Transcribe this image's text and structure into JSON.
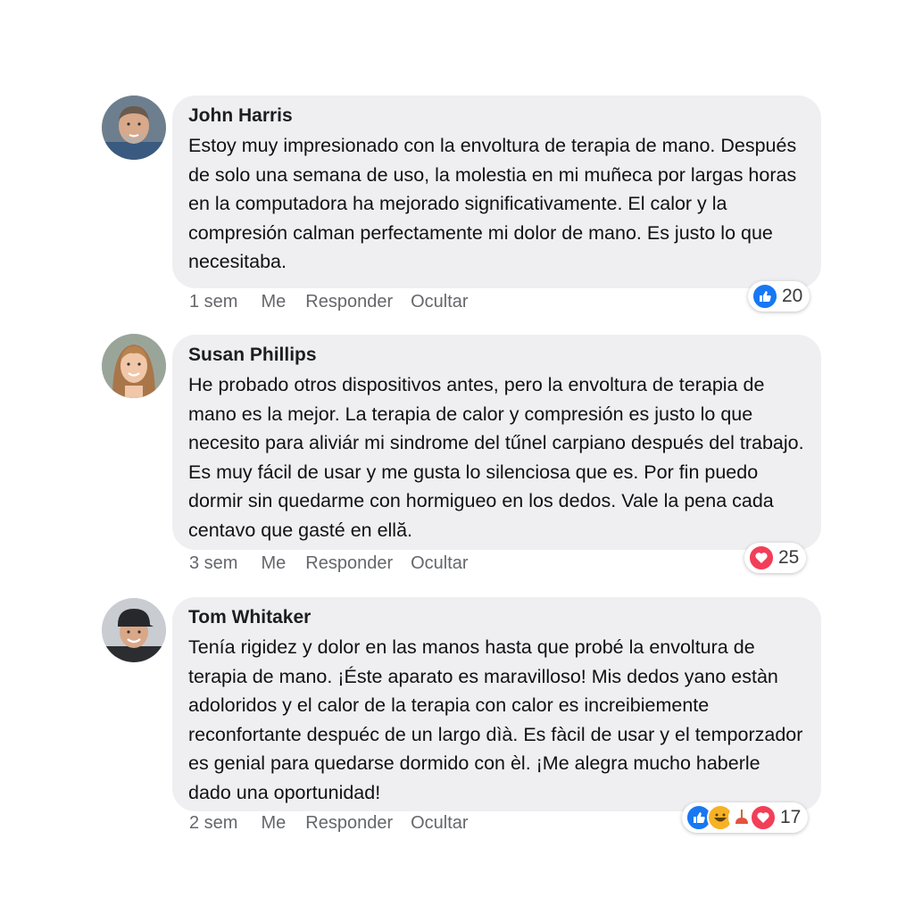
{
  "comments": [
    {
      "author": "John Harris",
      "text": "Estoy muy impresionado con la envoltura de terapia de mano. Después de solo una semana de uso, la molestia en mi muñeca por largas horas en la computadora ha mejorado significativamente. El calor y la compresión calman perfectamente mi dolor de mano. Es justo lo que necesitaba.",
      "time": "1 sem",
      "me_label": "Me",
      "reply_label": "Responder",
      "hide_label": "Ocultar",
      "reaction_count": "20",
      "reactions": [
        "like-icon"
      ]
    },
    {
      "author": "Susan Phillips",
      "text": "He probado otros dispositivos antes, pero la envoltura de terapia de mano es la mejor. La terapia de calor y compresión es justo lo que necesito para aliviár mi sindrome del tűnel carpiano después del trabajo. Es muy fácil de usar y me gusta lo silenciosa que es. Por fin puedo dormir sin quedarme con hormigueo en los dedos. Vale la pena cada centavo que gasté en ellă.",
      "time": "3 sem",
      "me_label": "Me",
      "reply_label": "Responder",
      "hide_label": "Ocultar",
      "reaction_count": "25",
      "reactions": [
        "heart-icon"
      ]
    },
    {
      "author": "Tom Whitaker",
      "text": "Tenía rigidez y dolor en las manos hasta que probé la envoltura de terapia de mano. ¡Éste aparato es maravilloso! Mis dedos yano estàn adoloridos y el calor de la terapia con calor es increibiemente reconfortante despuéc de un largo dìà. Es fàcil de usar y el temporzador es genial para quedarse dormido con èl. ¡Me alegra mucho haberle dado una oportunidad!",
      "time": "2 sem",
      "me_label": "Me",
      "reply_label": "Responder",
      "hide_label": "Ocultar",
      "reaction_count": "17",
      "reactions": [
        "like-icon",
        "laugh-icon",
        "plunger-icon",
        "heart-icon"
      ]
    }
  ],
  "colors": {
    "like": "#1877f2",
    "heart": "#f33e58",
    "laugh": "#f7b125",
    "bubble": "#efeff2",
    "meta_text": "#65676b"
  }
}
